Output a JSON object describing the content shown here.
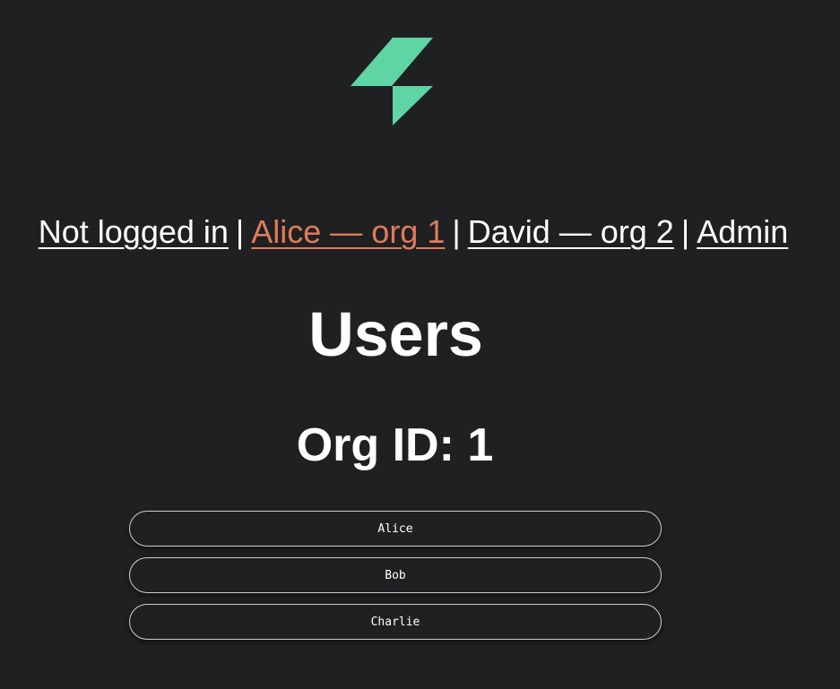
{
  "brand": {
    "logo_icon": "lightning-bolt-logo",
    "logo_color": "#5fd4a4"
  },
  "nav": {
    "not_logged_in": "Not logged in",
    "alice": "Alice — org 1",
    "david": "David — org 2",
    "admin": "Admin",
    "separator": "|",
    "active_color": "#e07b5b"
  },
  "main": {
    "title": "Users",
    "org_label": "Org ID: 1",
    "users": [
      {
        "name": "Alice"
      },
      {
        "name": "Bob"
      },
      {
        "name": "Charlie"
      }
    ]
  }
}
